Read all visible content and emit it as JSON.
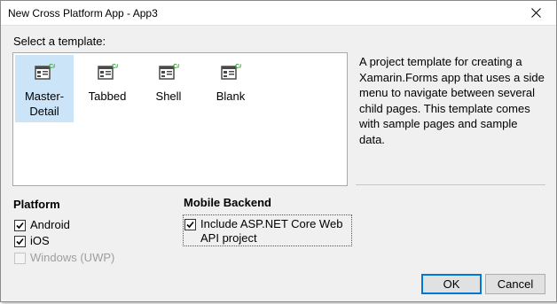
{
  "window": {
    "title": "New Cross Platform App - App3"
  },
  "template_section": {
    "label": "Select a template:",
    "templates": [
      {
        "line1": "Master-",
        "line2": "Detail",
        "selected": true
      },
      {
        "line1": "Tabbed",
        "line2": "",
        "selected": false
      },
      {
        "line1": "Shell",
        "line2": "",
        "selected": false
      },
      {
        "line1": "Blank",
        "line2": "",
        "selected": false
      }
    ],
    "description": "A project template for creating a Xamarin.Forms app that uses a side menu to navigate between several child pages. This template comes with sample pages and sample data."
  },
  "platform": {
    "title": "Platform",
    "options": [
      {
        "label": "Android",
        "checked": true,
        "enabled": true
      },
      {
        "label": "iOS",
        "checked": true,
        "enabled": true
      },
      {
        "label": "Windows (UWP)",
        "checked": false,
        "enabled": false
      }
    ]
  },
  "backend": {
    "title": "Mobile Backend",
    "option": {
      "label": "Include ASP.NET Core Web API project",
      "checked": true
    }
  },
  "buttons": {
    "ok": "OK",
    "cancel": "Cancel"
  },
  "colors": {
    "selection": "#cce4f7",
    "default_button_border": "#0078d7",
    "icon_green": "#3aa83a",
    "icon_gray": "#4a4a4a"
  },
  "icons": {
    "template": "template-icon",
    "close": "close-icon",
    "check": "checkmark-icon"
  }
}
